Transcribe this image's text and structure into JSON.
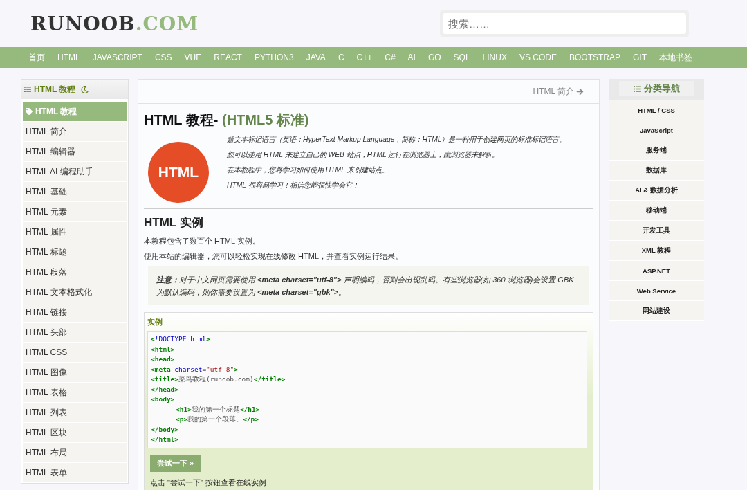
{
  "logo": {
    "main": "RUNOOB",
    "accent": ".COM"
  },
  "search": {
    "placeholder": "搜索……"
  },
  "nav": [
    "首页",
    "HTML",
    "JAVASCRIPT",
    "CSS",
    "VUE",
    "REACT",
    "PYTHON3",
    "JAVA",
    "C",
    "C++",
    "C#",
    "AI",
    "GO",
    "SQL",
    "LINUX",
    "VS CODE",
    "BOOTSTRAP",
    "GIT",
    "本地书签"
  ],
  "sidebar": {
    "title": "HTML 教程",
    "items": [
      {
        "label": "HTML 教程",
        "selected": true
      },
      {
        "label": "HTML 简介",
        "selected": false
      },
      {
        "label": "HTML 编辑器",
        "selected": false
      },
      {
        "label": "HTML AI 编程助手",
        "selected": false
      },
      {
        "label": "HTML 基础",
        "selected": false
      },
      {
        "label": "HTML 元素",
        "selected": false
      },
      {
        "label": "HTML 属性",
        "selected": false
      },
      {
        "label": "HTML 标题",
        "selected": false
      },
      {
        "label": "HTML 段落",
        "selected": false
      },
      {
        "label": "HTML 文本格式化",
        "selected": false
      },
      {
        "label": "HTML 链接",
        "selected": false
      },
      {
        "label": "HTML 头部",
        "selected": false
      },
      {
        "label": "HTML CSS",
        "selected": false
      },
      {
        "label": "HTML 图像",
        "selected": false
      },
      {
        "label": "HTML 表格",
        "selected": false
      },
      {
        "label": "HTML 列表",
        "selected": false
      },
      {
        "label": "HTML 区块",
        "selected": false
      },
      {
        "label": "HTML 布局",
        "selected": false
      },
      {
        "label": "HTML 表单",
        "selected": false
      }
    ]
  },
  "main": {
    "next_link": "HTML 简介",
    "title": "HTML 教程-",
    "title_accent": "(HTML5 标准)",
    "logo_text": "HTML",
    "intro": [
      "超文本标记语言（英语：HyperText Markup Language，简称：HTML）是一种用于创建网页的标准标记语言。",
      "您可以使用 HTML 来建立自己的 WEB 站点，HTML 运行在浏览器上，由浏览器来解析。",
      "在本教程中，您将学习如何使用 HTML 来创建站点。",
      "HTML 很容易学习！相信您能很快学会它！"
    ],
    "section_title": "HTML 实例",
    "paragraphs": [
      "本教程包含了数百个 HTML 实例。",
      "使用本站的编辑器，您可以轻松实现在线修改 HTML，并查看实例运行结果。"
    ],
    "note": "**注意：**对于中文网页需要使用 **<meta charset=\"utf-8\">** 声明编码，否则会出现乱码。有些浏览器(如 360 浏览器)会设置 GBK 为默认编码，则你需要设置为 **<meta charset=\"gbk\">**。",
    "example": {
      "label": "实例",
      "code": [
        {
          "indented": false,
          "parts": [
            {
              "kind": "tag",
              "text": "<"
            },
            {
              "kind": "attr",
              "text": "!DOCTYPE html"
            },
            {
              "kind": "tag",
              "text": ">"
            }
          ]
        },
        {
          "indented": false,
          "parts": [
            {
              "kind": "tag",
              "text": "<html>"
            }
          ]
        },
        {
          "indented": false,
          "parts": [
            {
              "kind": "tag",
              "text": "<head>"
            }
          ]
        },
        {
          "indented": false,
          "parts": [
            {
              "kind": "tag",
              "text": "<meta "
            },
            {
              "kind": "attr",
              "text": "charset"
            },
            {
              "kind": "text",
              "text": "="
            },
            {
              "kind": "value",
              "text": "\"utf-8\""
            },
            {
              "kind": "tag",
              "text": ">"
            }
          ]
        },
        {
          "indented": false,
          "parts": [
            {
              "kind": "tag",
              "text": "<title>"
            },
            {
              "kind": "text",
              "text": "菜鸟教程(runoob.com)"
            },
            {
              "kind": "tag",
              "text": "</title>"
            }
          ]
        },
        {
          "indented": false,
          "parts": [
            {
              "kind": "tag",
              "text": "</head>"
            }
          ]
        },
        {
          "indented": false,
          "parts": [
            {
              "kind": "tag",
              "text": "<body>"
            }
          ]
        },
        {
          "indented": true,
          "parts": [
            {
              "kind": "tag",
              "text": "<h1>"
            },
            {
              "kind": "text",
              "text": "我的第一个标题"
            },
            {
              "kind": "tag",
              "text": "</h1>"
            }
          ]
        },
        {
          "indented": true,
          "parts": [
            {
              "kind": "tag",
              "text": "<p>"
            },
            {
              "kind": "text",
              "text": "我的第一个段落。"
            },
            {
              "kind": "tag",
              "text": "</p>"
            }
          ]
        },
        {
          "indented": false,
          "parts": [
            {
              "kind": "tag",
              "text": "</body>"
            }
          ]
        },
        {
          "indented": false,
          "parts": [
            {
              "kind": "tag",
              "text": "</html>"
            }
          ]
        }
      ],
      "button": "尝试一下 »",
      "hint": "点击 \"尝试一下\" 按钮查看在线实例"
    }
  },
  "categories": {
    "title": "分类导航",
    "items": [
      "HTML / CSS",
      "JavaScript",
      "服务端",
      "数据库",
      "AI & 数据分析",
      "移动端",
      "开发工具",
      "XML 教程",
      "ASP.NET",
      "Web Service",
      "网站建设"
    ]
  }
}
